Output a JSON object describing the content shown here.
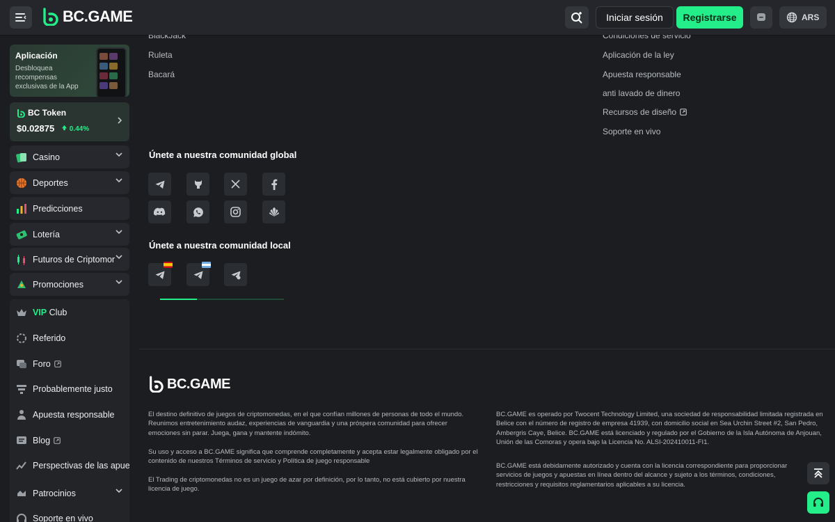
{
  "brand": {
    "name": "BC.GAME",
    "accent": "#24ee89"
  },
  "header": {
    "login_label": "Iniciar sesión",
    "register_label": "Registrarse",
    "currency": "ARS"
  },
  "sidebar": {
    "app_card": {
      "title": "Aplicación",
      "description": "Desbloquea recompensas exclusivas de la App"
    },
    "token": {
      "name": "BC Token",
      "price": "$0.02875",
      "change": "0.44%"
    },
    "items": [
      {
        "label": "Casino",
        "icon": "casino-icon",
        "expandable": true
      },
      {
        "label": "Deportes",
        "icon": "sports-icon",
        "expandable": true
      },
      {
        "label": "Predicciones",
        "icon": "predictions-icon",
        "expandable": false
      },
      {
        "label": "Lotería",
        "icon": "lottery-icon",
        "expandable": true
      },
      {
        "label": "Futuros de Criptomonedas",
        "icon": "futures-icon",
        "expandable": true
      },
      {
        "label": "Promociones",
        "icon": "promotions-icon",
        "expandable": true
      }
    ],
    "vip": {
      "prefix": "VIP",
      "suffix": "Club"
    },
    "group": [
      {
        "label": "Referido",
        "icon": "referral-icon"
      },
      {
        "label": "Foro",
        "icon": "forum-icon"
      },
      {
        "label": "Probablemente justo",
        "icon": "provably-fair-icon"
      },
      {
        "label": "Apuesta responsable",
        "icon": "responsible-gambling-icon"
      },
      {
        "label": "Blog",
        "icon": "blog-icon"
      },
      {
        "label": "Perspectivas de las apuestas",
        "icon": "insights-icon"
      },
      {
        "label": "Patrocinios",
        "icon": "sponsorship-icon"
      },
      {
        "label": "Soporte en vivo",
        "icon": "headset-icon"
      }
    ]
  },
  "main": {
    "games_links": [
      "BlackJack",
      "Ruleta",
      "Bacará"
    ],
    "legal_links": [
      "Condiciones de servicio",
      "Aplicación de la ley",
      "Apuesta responsable",
      "anti lavado de dinero",
      "Recursos de diseño",
      "Soporte en vivo"
    ],
    "global_community": {
      "title": "Únete a nuestra comunidad global",
      "icons": [
        "telegram-icon",
        "github-icon",
        "x-icon",
        "facebook-icon",
        "discord-icon",
        "whatsapp-icon",
        "instagram-icon",
        "huawei-icon"
      ]
    },
    "local_community": {
      "title": "Únete a nuestra comunidad local",
      "icons": [
        "telegram-spain-icon",
        "telegram-argentina-icon",
        "telegram-alt-icon"
      ]
    },
    "carousel_progress": 0.3,
    "footer": {
      "left_paragraphs": [
        "El destino definitivo de juegos de criptomonedas, en el que confían millones de personas de todo el mundo. Reunimos entretenimiento audaz, experiencias de vanguardia y una próspera comunidad para ofrecer emociones sin parar. Juega, gana y mantente indómito.",
        "Su uso y acceso a BC.GAME significa que comprende completamente y acepta estar legalmente obligado por el contenido de nuestros Términos de servicio y Política de juego responsable",
        "El Trading de criptomonedas no es un juego de azar por definición, por lo tanto, no está cubierto por nuestra licencia de juego."
      ],
      "right_paragraphs": [
        "BC.GAME es operado por Twocent Technology Limited, una sociedad de responsabilidad limitada registrada en Belice con el número de registro de empresa 41939, con domicilio social en Sea Urchin Street #2, San Pedro, Ambergris Caye, Belice. BC.GAME está licenciado y regulado por el Gobierno de la Isla Autónoma de Anjouan, Unión de las Comoras y opera bajo la Licencia No. ALSI-202410011-FI1.",
        "BC.GAME está debidamente autorizado y cuenta con la licencia correspondiente para proporcionar servicios de juegos y apuestas en línea dentro del alcance y sujeto a los términos, condiciones, restricciones y requisitos reglamentarios aplicables a su licencia."
      ]
    }
  }
}
